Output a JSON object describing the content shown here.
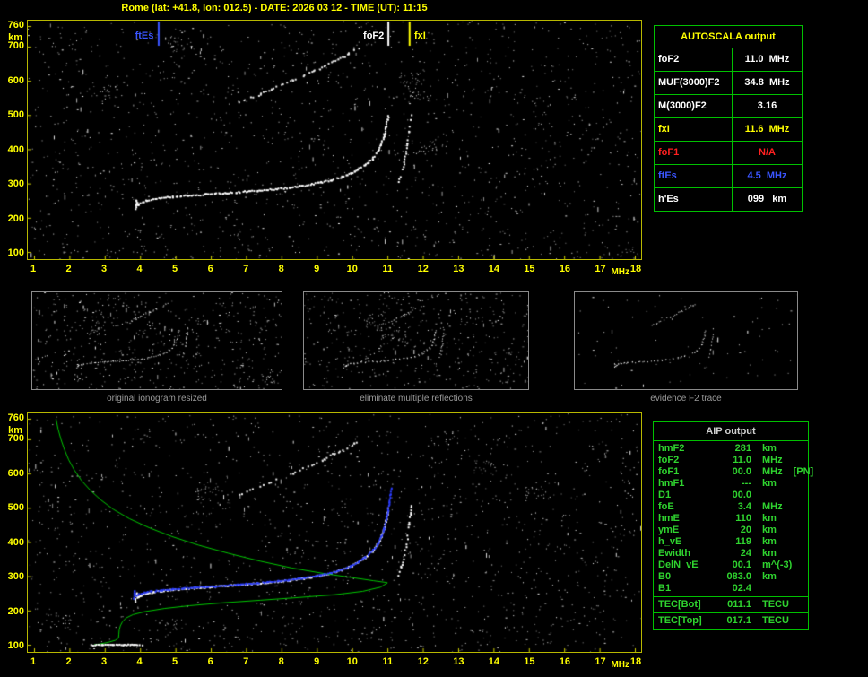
{
  "title": "Rome (lat: +41.8, lon: 012.5) - DATE: 2026 03 12 - TIME (UT): 11:15",
  "colors": {
    "accent_yellow": "#ffff00",
    "plot_border": "#b8b800",
    "table_green": "#00c000",
    "aip_text": "#2fd32f",
    "marker_blue": "#3a55ff",
    "alert_red": "#ff2020",
    "caption_gray": "#9a9a9a"
  },
  "autoscala_table": {
    "title": "AUTOSCALA output",
    "rows": [
      {
        "label": "foF2",
        "value": "11.0  MHz",
        "color": "#ffffff"
      },
      {
        "label": "MUF(3000)F2",
        "value": "34.8  MHz",
        "color": "#ffffff"
      },
      {
        "label": "M(3000)F2",
        "value": "3.16",
        "color": "#ffffff"
      },
      {
        "label": "fxI",
        "value": "11.6  MHz",
        "color": "#ffff00"
      },
      {
        "label": "foF1",
        "value": "N/A",
        "color": "#ff2020"
      },
      {
        "label": "ftEs",
        "value": "4.5  MHz",
        "color": "#3a55ff"
      },
      {
        "label": "h'Es",
        "value": "099   km",
        "color": "#ffffff"
      }
    ]
  },
  "aip_table": {
    "title": "AIP output",
    "rows": [
      {
        "label": "hmF2",
        "value": "281",
        "unit": "km"
      },
      {
        "label": "foF2",
        "value": "11.0",
        "unit": "MHz"
      },
      {
        "label": "foF1",
        "value": "00.0",
        "unit": "MHz",
        "note": "[PN]"
      },
      {
        "label": "hmF1",
        "value": "---",
        "unit": "km"
      },
      {
        "label": "D1",
        "value": "00.0",
        "unit": ""
      },
      {
        "label": "foE",
        "value": "3.4",
        "unit": "MHz"
      },
      {
        "label": "hmE",
        "value": "110",
        "unit": "km"
      },
      {
        "label": "ymE",
        "value": "20",
        "unit": "km"
      },
      {
        "label": "h_vE",
        "value": "119",
        "unit": "km"
      },
      {
        "label": "Ewidth",
        "value": "24",
        "unit": "km"
      },
      {
        "label": "DelN_vE",
        "value": "00.1",
        "unit": "m^(-3)"
      },
      {
        "label": "B0",
        "value": "083.0",
        "unit": "km"
      },
      {
        "label": "B1",
        "value": "02.4",
        "unit": ""
      }
    ],
    "tec_rows": [
      {
        "label": "TEC[Bot]",
        "value": "011.1",
        "unit": "TECU"
      },
      {
        "label": "TEC[Top]",
        "value": "017.1",
        "unit": "TECU"
      }
    ]
  },
  "chart_data": {
    "type": "scatter",
    "x_axis": {
      "unit": "MHz",
      "min": 1,
      "max": 18,
      "ticks": [
        1,
        2,
        3,
        4,
        5,
        6,
        7,
        8,
        9,
        10,
        11,
        12,
        13,
        14,
        15,
        16,
        17,
        18
      ]
    },
    "y_axis": {
      "unit": "km",
      "min": 100,
      "max": 760,
      "ticks": [
        100,
        200,
        300,
        400,
        500,
        600,
        700,
        760
      ]
    },
    "top_plot": {
      "markers": [
        {
          "label": "ftEs",
          "freq": 4.5,
          "color": "#3a55ff",
          "side": "left"
        },
        {
          "label": "foF2",
          "freq": 11.0,
          "color": "#ffffff",
          "side": "left"
        },
        {
          "label": "fxI",
          "freq": 11.6,
          "color": "#ffff00",
          "side": "right"
        }
      ],
      "noise": {
        "dots": 1500,
        "streaks": 80,
        "clusters": 6,
        "seed": 42
      },
      "traces": [
        {
          "name": "first_hop",
          "color": "#ffffff",
          "size": 2,
          "step": 2,
          "density": 0.92,
          "jitter": 0.8,
          "seed": 11,
          "points": [
            [
              3.85,
              228
            ],
            [
              3.88,
              252
            ],
            [
              3.92,
              240
            ],
            [
              4.0,
              246
            ],
            [
              4.15,
              251
            ],
            [
              4.35,
              256
            ],
            [
              4.6,
              260
            ],
            [
              4.9,
              263
            ],
            [
              5.2,
              266
            ],
            [
              5.5,
              268
            ],
            [
              5.8,
              270
            ],
            [
              6.1,
              272
            ],
            [
              6.4,
              274
            ],
            [
              6.7,
              276
            ],
            [
              7.0,
              279
            ],
            [
              7.3,
              281
            ],
            [
              7.6,
              284
            ],
            [
              7.9,
              287
            ],
            [
              8.2,
              290
            ],
            [
              8.5,
              294
            ],
            [
              8.8,
              299
            ],
            [
              9.1,
              305
            ],
            [
              9.4,
              312
            ],
            [
              9.7,
              321
            ],
            [
              9.95,
              331
            ],
            [
              10.15,
              343
            ],
            [
              10.35,
              357
            ],
            [
              10.55,
              374
            ],
            [
              10.7,
              394
            ],
            [
              10.8,
              416
            ],
            [
              10.88,
              440
            ],
            [
              10.94,
              465
            ],
            [
              10.98,
              488
            ],
            [
              11.0,
              500
            ]
          ]
        },
        {
          "name": "second_hop",
          "color": "#e8e8e8",
          "size": 2,
          "step": 3,
          "density": 0.6,
          "jitter": 1,
          "seed": 12,
          "points": [
            [
              6.8,
              540
            ],
            [
              7.1,
              552
            ],
            [
              7.4,
              564
            ],
            [
              7.7,
              577
            ],
            [
              8.0,
              590
            ],
            [
              8.3,
              603
            ],
            [
              8.6,
              617
            ],
            [
              8.9,
              631
            ],
            [
              9.2,
              645
            ],
            [
              9.45,
              658
            ],
            [
              9.7,
              670
            ],
            [
              9.9,
              681
            ],
            [
              10.05,
              690
            ],
            [
              10.18,
              698
            ]
          ]
        },
        {
          "name": "x_mode",
          "color": "#ffffff",
          "size": 2,
          "step": 3,
          "density": 0.65,
          "jitter": 0.8,
          "seed": 13,
          "points": [
            [
              11.3,
              305
            ],
            [
              11.38,
              330
            ],
            [
              11.45,
              358
            ],
            [
              11.5,
              388
            ],
            [
              11.55,
              420
            ],
            [
              11.59,
              452
            ],
            [
              11.63,
              482
            ],
            [
              11.66,
              510
            ]
          ]
        },
        {
          "name": "es",
          "color": "#d0d0d0",
          "size": 1,
          "step": 5,
          "density": 0.3,
          "jitter": 1.5,
          "seed": 14,
          "points": [
            [
              1.4,
              101
            ],
            [
              2.0,
              102
            ],
            [
              2.6,
              101
            ],
            [
              3.2,
              103
            ],
            [
              3.8,
              102
            ],
            [
              4.4,
              101
            ]
          ]
        }
      ]
    },
    "bottom_plot": {
      "noise": {
        "dots": 1500,
        "streaks": 80,
        "clusters": 6,
        "seed": 77
      },
      "inherit": [
        "first_hop",
        "second_hop",
        "x_mode"
      ],
      "traces": [
        {
          "name": "profile",
          "render": "line",
          "color": "#00c800",
          "width": 1,
          "points": [
            [
              1.62,
              760
            ],
            [
              1.68,
              730
            ],
            [
              1.76,
              700
            ],
            [
              1.86,
              670
            ],
            [
              1.98,
              640
            ],
            [
              2.14,
              610
            ],
            [
              2.34,
              580
            ],
            [
              2.6,
              550
            ],
            [
              2.9,
              522
            ],
            [
              3.25,
              495
            ],
            [
              3.7,
              468
            ],
            [
              4.25,
              442
            ],
            [
              4.9,
              416
            ],
            [
              5.65,
              391
            ],
            [
              6.5,
              367
            ],
            [
              7.4,
              344
            ],
            [
              8.3,
              324
            ],
            [
              9.2,
              308
            ],
            [
              10.0,
              296
            ],
            [
              10.6,
              287
            ],
            [
              10.95,
              282
            ],
            [
              11.0,
              281
            ],
            [
              10.8,
              268
            ],
            [
              10.3,
              256
            ],
            [
              9.5,
              246
            ],
            [
              8.5,
              238
            ],
            [
              7.4,
              230
            ],
            [
              6.3,
              222
            ],
            [
              5.4,
              214
            ],
            [
              4.7,
              206
            ],
            [
              4.15,
              197
            ],
            [
              3.8,
              188
            ],
            [
              3.6,
              178
            ],
            [
              3.5,
              167
            ],
            [
              3.44,
              155
            ],
            [
              3.41,
              143
            ],
            [
              3.4,
              131
            ],
            [
              3.39,
              120
            ],
            [
              3.3,
              113
            ],
            [
              3.1,
              107
            ],
            [
              2.85,
              102
            ],
            [
              2.7,
              100
            ]
          ]
        },
        {
          "name": "scaled_trace",
          "color": "#2a3cff",
          "size": 2,
          "step": 2,
          "density": 0.95,
          "jitter": 0.6,
          "seed": 21,
          "points": [
            [
              3.8,
              236
            ],
            [
              3.83,
              258
            ],
            [
              3.87,
              246
            ],
            [
              3.95,
              250
            ],
            [
              4.1,
              254
            ],
            [
              4.3,
              258
            ],
            [
              4.6,
              261
            ],
            [
              4.9,
              264
            ],
            [
              5.2,
              267
            ],
            [
              5.5,
              269
            ],
            [
              5.8,
              271
            ],
            [
              6.1,
              273
            ],
            [
              6.4,
              275
            ],
            [
              6.7,
              277
            ],
            [
              7.0,
              280
            ],
            [
              7.3,
              282
            ],
            [
              7.6,
              285
            ],
            [
              7.9,
              288
            ],
            [
              8.2,
              291
            ],
            [
              8.5,
              295
            ],
            [
              8.8,
              300
            ],
            [
              9.1,
              306
            ],
            [
              9.4,
              313
            ],
            [
              9.7,
              322
            ],
            [
              9.95,
              332
            ],
            [
              10.15,
              344
            ],
            [
              10.35,
              358
            ],
            [
              10.55,
              375
            ],
            [
              10.7,
              395
            ],
            [
              10.8,
              417
            ],
            [
              10.88,
              441
            ],
            [
              10.94,
              466
            ],
            [
              10.99,
              492
            ],
            [
              11.03,
              518
            ],
            [
              11.07,
              542
            ],
            [
              11.1,
              560
            ]
          ]
        },
        {
          "name": "es_layer",
          "color": "#ffffff",
          "size": 2,
          "step": 2,
          "density": 0.95,
          "jitter": 0.5,
          "seed": 22,
          "points": [
            [
              2.6,
              101
            ],
            [
              2.9,
              102
            ],
            [
              3.2,
              102
            ],
            [
              3.5,
              102
            ],
            [
              3.8,
              102
            ],
            [
              4.05,
              101
            ]
          ]
        }
      ]
    },
    "thumbnails": [
      {
        "caption": "original ionogram resized",
        "trace_names": [
          "first_hop",
          "second_hop",
          "x_mode"
        ],
        "noise": {
          "dots": 520,
          "streaks": 30,
          "clusters": 2,
          "seed": 31
        }
      },
      {
        "caption": "eliminate multiple reflections",
        "trace_names": [
          "first_hop",
          "second_hop",
          "x_mode"
        ],
        "noise": {
          "dots": 430,
          "streaks": 24,
          "clusters": 2,
          "seed": 32
        }
      },
      {
        "caption": "evidence F2 trace",
        "trace_names": [
          "first_hop",
          "second_hop",
          "x_mode"
        ],
        "noise": {
          "dots": 70,
          "streaks": 6,
          "clusters": 0,
          "seed": 33
        }
      }
    ]
  }
}
